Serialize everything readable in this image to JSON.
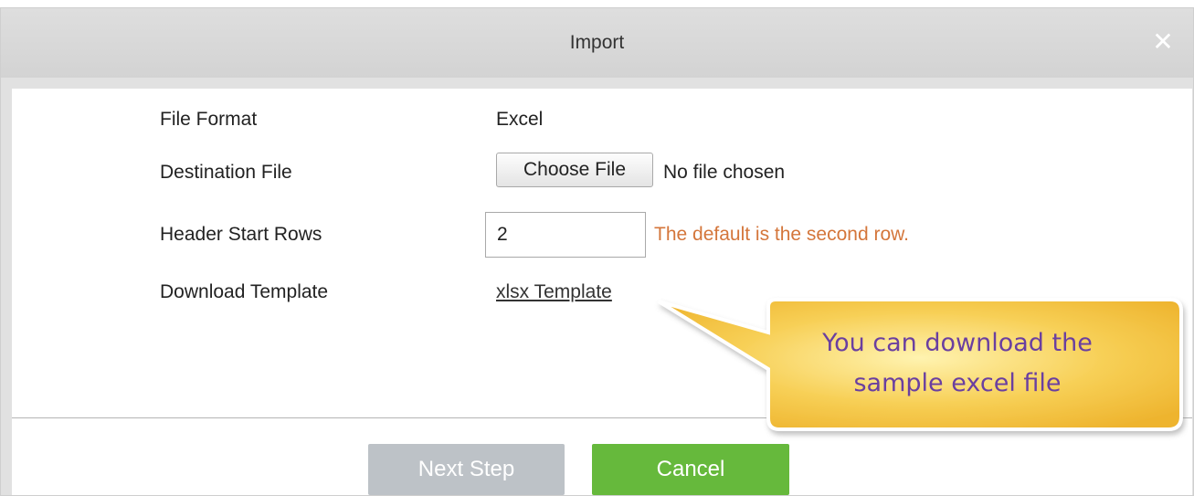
{
  "dialog": {
    "title": "Import",
    "close_symbol": "✕"
  },
  "form": {
    "file_format_label": "File Format",
    "file_format_value": "Excel",
    "destination_label": "Destination File",
    "choose_file_label": "Choose File",
    "file_status": "No file chosen",
    "header_rows_label": "Header Start Rows",
    "header_rows_value": "2",
    "header_rows_hint": "The default is the second row.",
    "download_label": "Download Template",
    "template_link": "xlsx Template"
  },
  "callout": {
    "line1": "You can download the",
    "line2": "sample excel file"
  },
  "footer": {
    "next_label": "Next Step",
    "cancel_label": "Cancel"
  },
  "colors": {
    "titlebar": "#d6d6d6",
    "hint": "#d4763b",
    "callout_fill": "#f5c242",
    "callout_text": "#6a3fa0",
    "next_disabled": "#bdc2c7",
    "cancel": "#66b93c"
  }
}
